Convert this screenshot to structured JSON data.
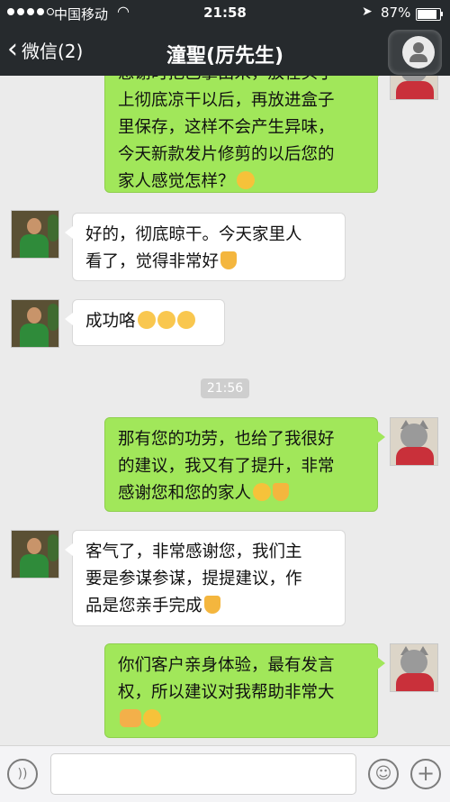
{
  "status_bar": {
    "carrier": "中国移动",
    "time": "21:58",
    "battery": "87%",
    "battery_level": 0.87
  },
  "nav": {
    "back_label": "微信(2)",
    "title": "潼聖(厉先生)"
  },
  "messages": [
    {
      "side": "out",
      "lines": [
        "感谢时把巴掌由米，放在头于",
        "上彻底凉干以后，再放进盒子",
        "里保存，这样不会产生异味，",
        "今天新款发片修剪的以后您的",
        "家人感觉怎样？"
      ],
      "emoji": [
        "smile"
      ]
    },
    {
      "side": "in",
      "lines": [
        "好的，彻底晾干。今天家里人",
        "看了，觉得非常好"
      ],
      "emoji": [
        "thumbs-up"
      ]
    },
    {
      "side": "in",
      "lines": [
        "成功咯"
      ],
      "emoji": [
        "hide-face",
        "hide-face",
        "hide-face"
      ]
    },
    {
      "side": "out",
      "lines": [
        "那有您的功劳，也给了我很好",
        "的建议，我又有了提升，非常",
        "感谢您和您的家人"
      ],
      "emoji": [
        "smile",
        "thumbs-up"
      ]
    },
    {
      "side": "in",
      "lines": [
        "客气了，非常感谢您，我们主",
        "要是参谋参谋，提提建议，作",
        "品是您亲手完成"
      ],
      "emoji": [
        "thumbs-up"
      ]
    },
    {
      "side": "out",
      "lines": [
        "你们客户亲身体验，最有发言",
        "权，所以建议对我帮助非常大",
        ""
      ],
      "emoji": [
        "handshake",
        "smile"
      ]
    }
  ],
  "timestamp": "21:56",
  "colors": {
    "nav_bg": "#262a2d",
    "out_bubble": "#a1e75a",
    "in_bubble": "#ffffff",
    "chat_bg": "#ebebeb"
  }
}
